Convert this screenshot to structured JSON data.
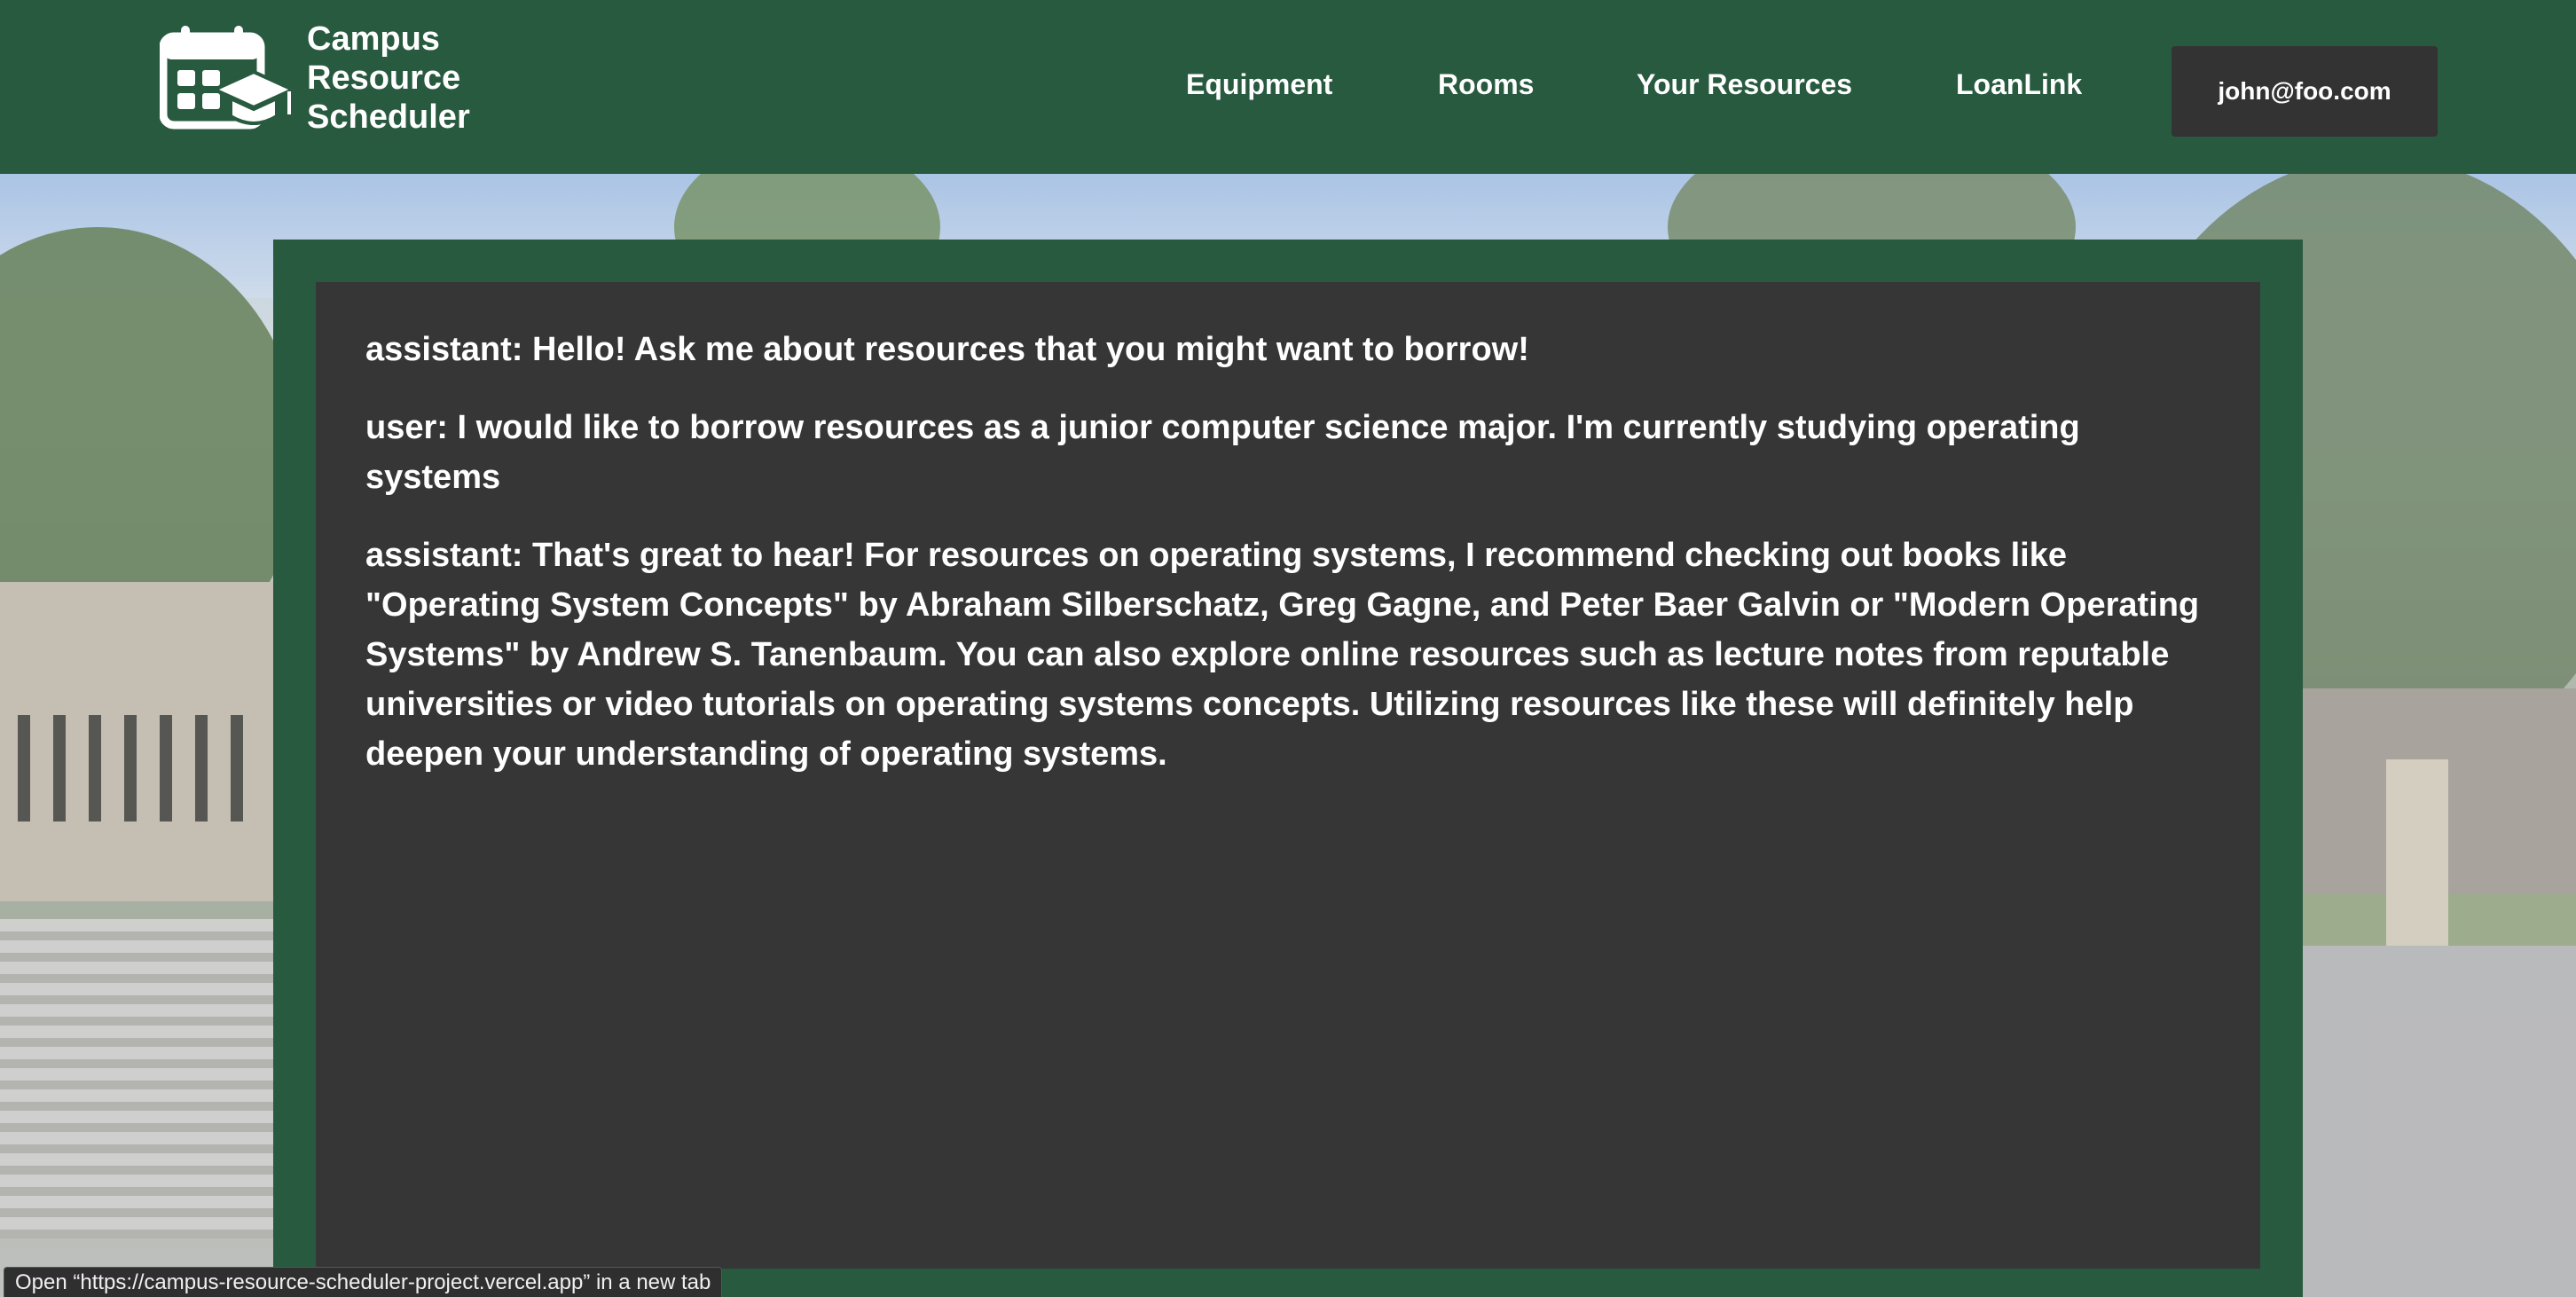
{
  "brand": {
    "name_lines": [
      "Campus",
      "Resource",
      "Scheduler"
    ],
    "icon": "calendar-graduation-cap-icon"
  },
  "nav": {
    "items": [
      {
        "label": "Equipment"
      },
      {
        "label": "Rooms"
      },
      {
        "label": "Your Resources"
      },
      {
        "label": "LoanLink"
      }
    ],
    "user_email": "john@foo.com"
  },
  "chat": {
    "messages": [
      {
        "text": "assistant: Hello! Ask me about resources that you might want to borrow!"
      },
      {
        "text": "user: I would like to borrow resources as a junior computer science major. I'm currently studying operating systems"
      },
      {
        "text": "assistant: That's great to hear! For resources on operating systems, I recommend checking out books like \"Operating System Concepts\" by Abraham Silberschatz, Greg Gagne, and Peter Baer Galvin or \"Modern Operating Systems\" by Andrew S. Tanenbaum. You can also explore online resources such as lecture notes from reputable universities or video tutorials on operating systems concepts. Utilizing resources like these will definitely help deepen your understanding of operating systems."
      }
    ]
  },
  "status_bar": {
    "text": "Open “https://campus-resource-scheduler-project.vercel.app” in a new tab"
  },
  "colors": {
    "brand_green": "#285a3f",
    "panel_dark": "#363636",
    "button_dark": "#333333"
  }
}
